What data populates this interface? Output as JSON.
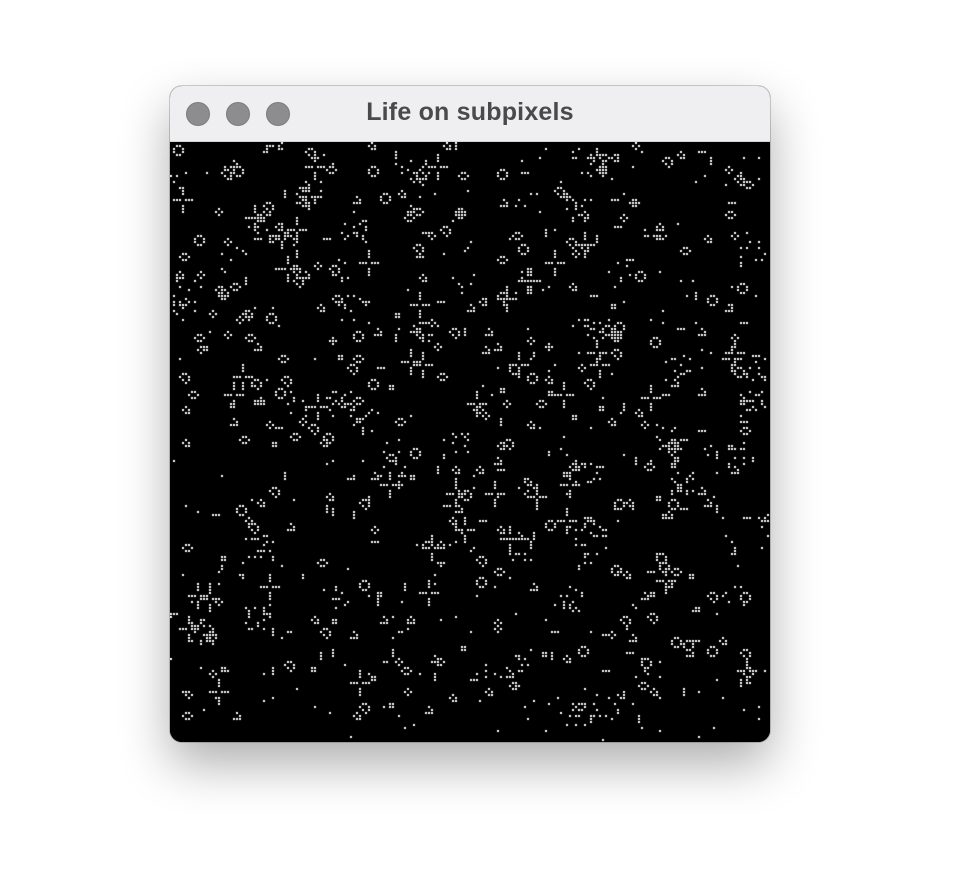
{
  "window": {
    "title": "Life on subpixels",
    "controls": [
      "close",
      "minimize",
      "zoom"
    ],
    "traffic_light_color": "#8d8d8f",
    "titlebar_color": "#efeff1"
  },
  "simulation": {
    "name": "Conway's Game of Life",
    "background_color": "#000000",
    "cell_color": "#ffffff"
  }
}
